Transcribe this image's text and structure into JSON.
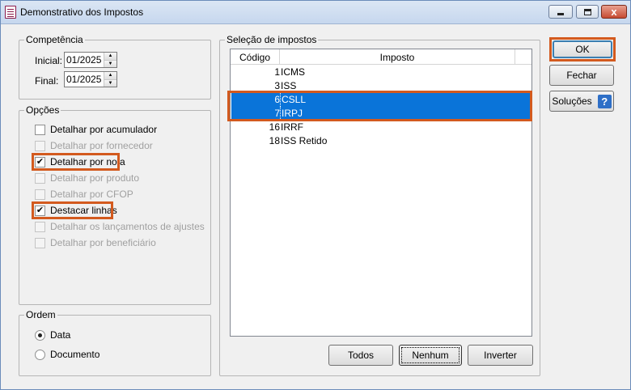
{
  "window": {
    "title": "Demonstrativo dos Impostos",
    "close_glyph": "x"
  },
  "competencia": {
    "legend": "Competência",
    "inicial_label": "Inicial:",
    "inicial_value": "01/2025",
    "final_label": "Final:",
    "final_value": "01/2025"
  },
  "opcoes": {
    "legend": "Opções",
    "items": [
      {
        "label": "Detalhar por acumulador",
        "checked": false,
        "enabled": true
      },
      {
        "label": "Detalhar por fornecedor",
        "checked": false,
        "enabled": false
      },
      {
        "label": "Detalhar por nota",
        "checked": true,
        "enabled": true
      },
      {
        "label": "Detalhar por produto",
        "checked": false,
        "enabled": false
      },
      {
        "label": "Detalhar por CFOP",
        "checked": false,
        "enabled": false
      },
      {
        "label": "Destacar linhas",
        "checked": true,
        "enabled": true
      },
      {
        "label": "Detalhar os lançamentos de ajustes",
        "checked": false,
        "enabled": false
      },
      {
        "label": "Detalhar por beneficiário",
        "checked": false,
        "enabled": false
      }
    ]
  },
  "ordem": {
    "legend": "Ordem",
    "options": [
      {
        "label": "Data",
        "selected": true
      },
      {
        "label": "Documento",
        "selected": false
      }
    ]
  },
  "selecao": {
    "legend": "Seleção de impostos",
    "columns": [
      "Código",
      "Imposto"
    ],
    "rows": [
      {
        "codigo": "1",
        "imposto": "ICMS",
        "selected": false
      },
      {
        "codigo": "3",
        "imposto": "ISS",
        "selected": false
      },
      {
        "codigo": "6",
        "imposto": "CSLL",
        "selected": true
      },
      {
        "codigo": "7",
        "imposto": "IRPJ",
        "selected": true
      },
      {
        "codigo": "16",
        "imposto": "IRRF",
        "selected": false
      },
      {
        "codigo": "18",
        "imposto": "ISS Retido",
        "selected": false
      }
    ],
    "buttons": {
      "todos": "Todos",
      "nenhum": "Nenhum",
      "inverter": "Inverter"
    }
  },
  "actions": {
    "ok": "OK",
    "fechar": "Fechar",
    "solucoes": "Soluções",
    "help_glyph": "?"
  },
  "colors": {
    "highlight": "#d35a1e",
    "selection": "#0a74d9"
  }
}
